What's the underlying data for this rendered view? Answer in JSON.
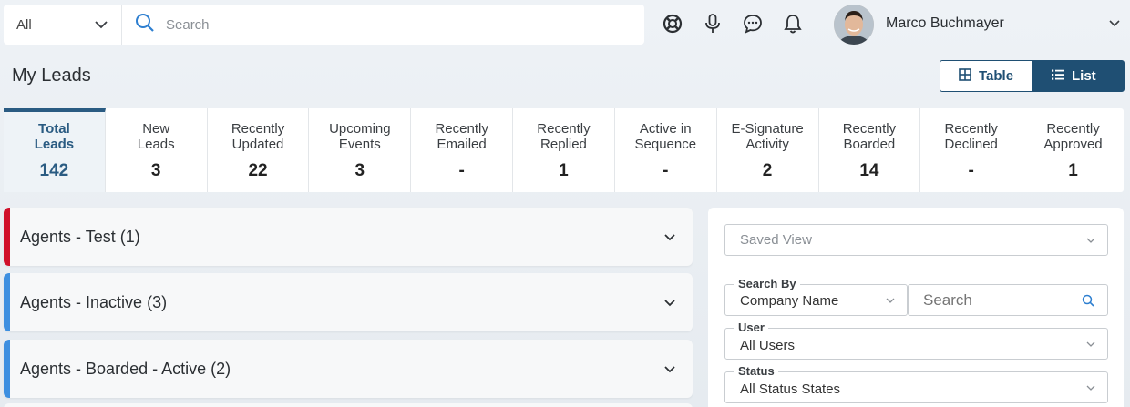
{
  "header": {
    "filter_select": {
      "value": "All"
    },
    "search": {
      "placeholder": "Search"
    },
    "icons": [
      "lifebuoy-icon",
      "microphone-icon",
      "chat-icon",
      "bell-icon"
    ],
    "user": {
      "name": "Marco Buchmayer"
    }
  },
  "page": {
    "title": "My Leads",
    "view_toggle": {
      "table_label": "Table",
      "list_label": "List",
      "active": "List"
    }
  },
  "stats": [
    {
      "label": "Total Leads",
      "count": "142",
      "active": true
    },
    {
      "label": "New Leads",
      "count": "3"
    },
    {
      "label": "Recently Updated",
      "count": "22"
    },
    {
      "label": "Upcoming Events",
      "count": "3"
    },
    {
      "label": "Recently Emailed",
      "count": "-"
    },
    {
      "label": "Recently Replied",
      "count": "1"
    },
    {
      "label": "Active in Sequence",
      "count": "-"
    },
    {
      "label": "E-Signature Activity",
      "count": "2"
    },
    {
      "label": "Recently Boarded",
      "count": "14"
    },
    {
      "label": "Recently Declined",
      "count": "-"
    },
    {
      "label": "Recently Approved",
      "count": "1"
    }
  ],
  "groups": [
    {
      "label": "Agents - Test (1)",
      "color": "#d0102a"
    },
    {
      "label": "Agents - Inactive (3)",
      "color": "#3d8fe0"
    },
    {
      "label": "Agents - Boarded - Active (2)",
      "color": "#3d8fe0"
    }
  ],
  "filters": {
    "saved_view": {
      "value": "Saved View"
    },
    "search_by": {
      "label": "Search By",
      "value": "Company Name",
      "search_placeholder": "Search"
    },
    "user": {
      "label": "User",
      "value": "All Users"
    },
    "status": {
      "label": "Status",
      "value": "All Status States"
    }
  },
  "colors": {
    "primary": "#1f4f73",
    "accent_blue": "#3d8fe0",
    "accent_red": "#d0102a"
  }
}
